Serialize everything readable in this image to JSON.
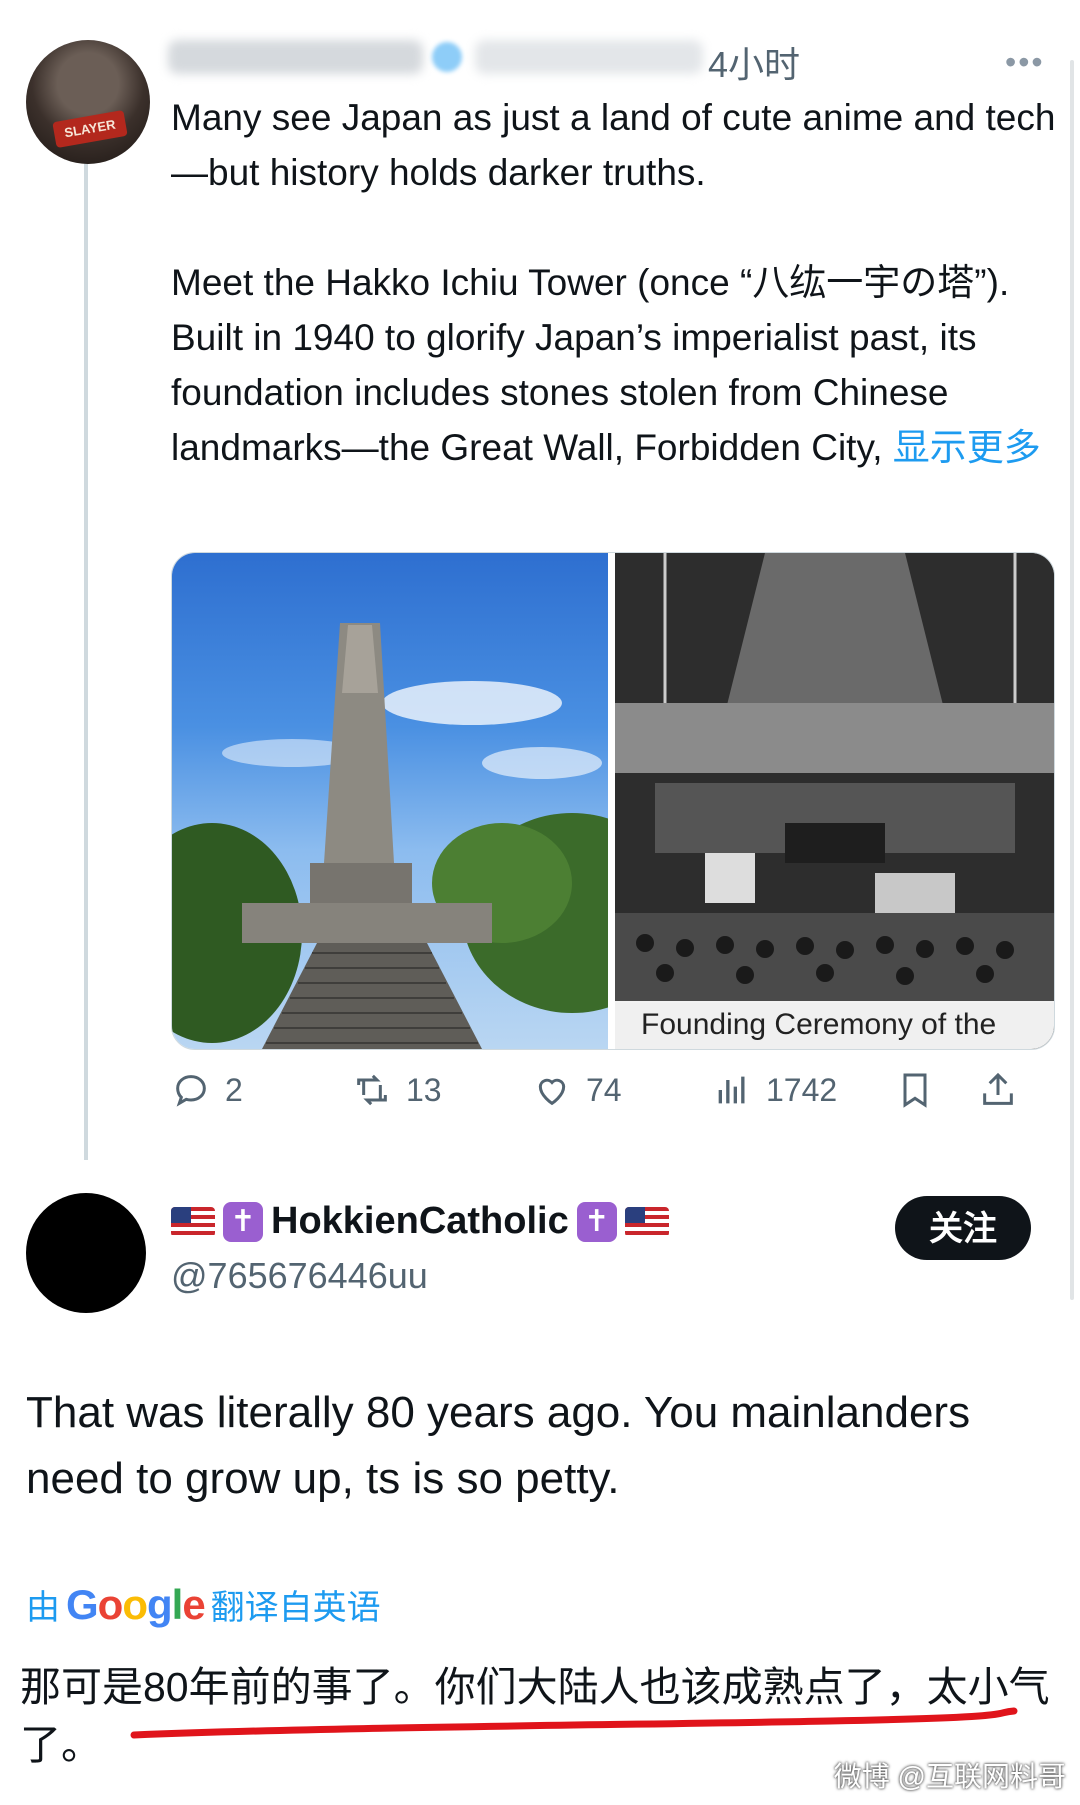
{
  "parent_tweet": {
    "time": "4小时",
    "paragraphs": [
      "Many see Japan as just a land of cute anime and tech—but history holds darker truths.",
      "Meet the Hakko Ichiu Tower (once “八纮一宇の塔”). Built in 1940 to glorify Japan’s imperialist past, its foundation includes stones stolen from Chinese landmarks—the Great Wall, Forbidden City,"
    ],
    "show_more": "显示更多",
    "media_caption": "Founding Ceremony of the",
    "stats": {
      "replies": "2",
      "reposts": "13",
      "likes": "74",
      "views": "1742"
    }
  },
  "reply": {
    "display_name": "HokkienCatholic",
    "handle": "@765676446uu",
    "follow_label": "关注",
    "text": "That was literally 80 years ago. You mainlanders need to grow up, ts is so petty.",
    "translated_prefix": "由",
    "translated_brand": "Google",
    "translated_suffix": "翻译自英语",
    "translation": "那可是80年前的事了。你们大陆人也该成熟点了，太小气了。"
  },
  "watermark": "微博 @互联网料哥",
  "colors": {
    "link": "#1d9bf0",
    "muted": "#536471",
    "underline": "#e0141b"
  }
}
